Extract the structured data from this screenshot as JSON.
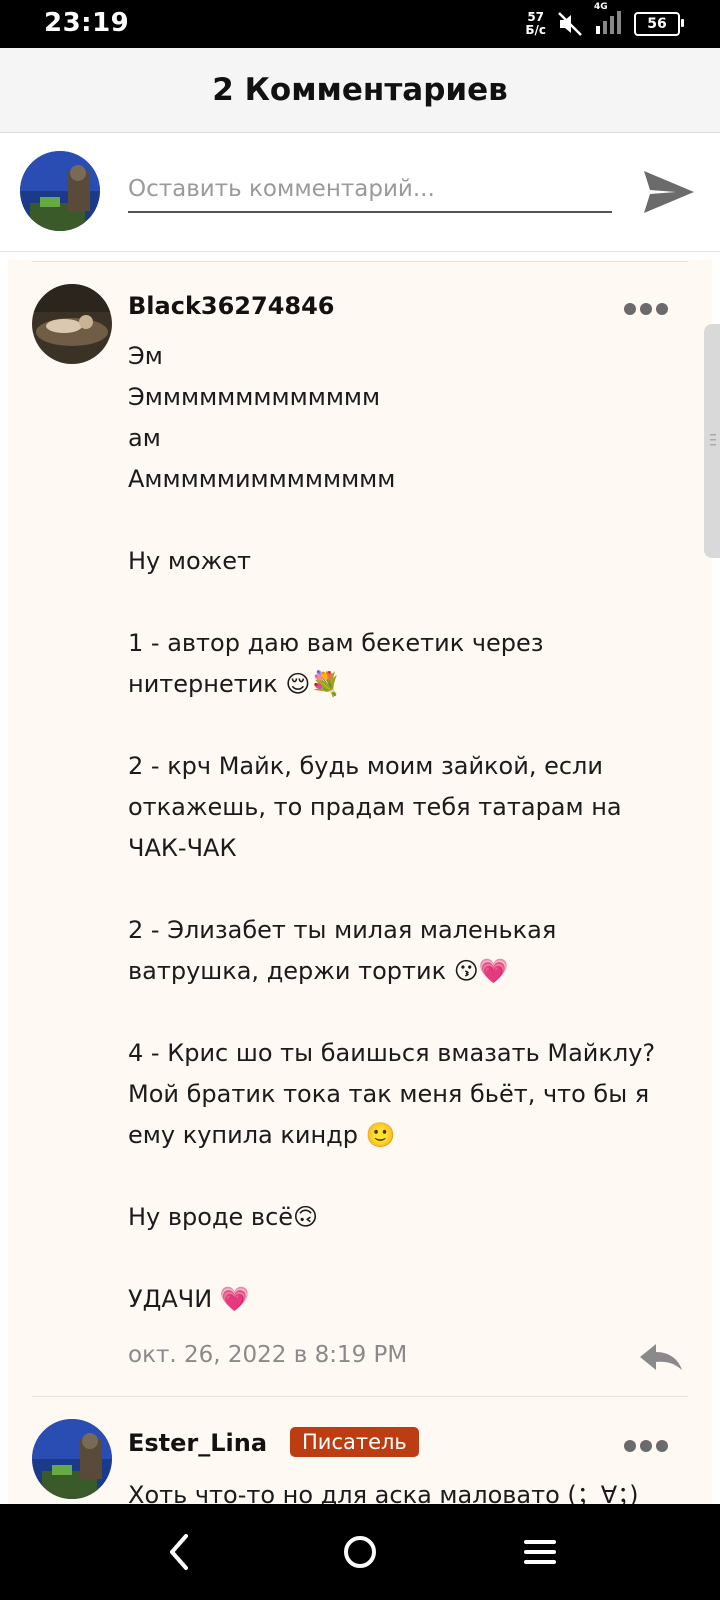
{
  "status_bar": {
    "time": "23:19",
    "net_speed_value": "57",
    "net_speed_unit": "Б/с",
    "network_type": "4G",
    "battery": "56"
  },
  "header": {
    "title": "2 Комментариев"
  },
  "compose": {
    "placeholder": "Оставить комментарий..."
  },
  "comments": [
    {
      "username": "Black36274846",
      "lines": [
        "Эм",
        "Эммммммммммммм",
        "ам",
        "Амммммимммммммм",
        "",
        "Ну может",
        "",
        "1 - автор даю вам бекетик через",
        "нитернетик 😌💐",
        "",
        "2 - крч Майк, будь моим зайкой, если",
        "откажешь, то прадам тебя татарам на",
        "ЧАК-ЧАК",
        "",
        "2 - Элизабет ты милая маленькая",
        "ватрушка, держи тортик 😗💗",
        "",
        "4 - Крис шо ты баишься вмазать Майклу?",
        "Мой братик тока так меня бьёт, что бы я",
        "ему купила киндр 🙂",
        "",
        "Ну вроде всё🙃",
        "",
        "УДАЧИ 💗"
      ],
      "timestamp": "окт. 26, 2022 в 8:19 PM"
    },
    {
      "username": "Ester_Lina",
      "badge": "Писатель",
      "text": "Хоть что-то но для аска маловато (；∀；)"
    }
  ],
  "colors": {
    "comment_bg": "#fff9f4",
    "badge": "#bc3d12",
    "header_bg": "#f5f5f6"
  },
  "icons": {
    "send": "send-icon",
    "more": "more-dots-icon",
    "reply": "reply-icon",
    "nav_back": "back-icon",
    "nav_home": "home-icon",
    "nav_menu": "menu-icon"
  }
}
